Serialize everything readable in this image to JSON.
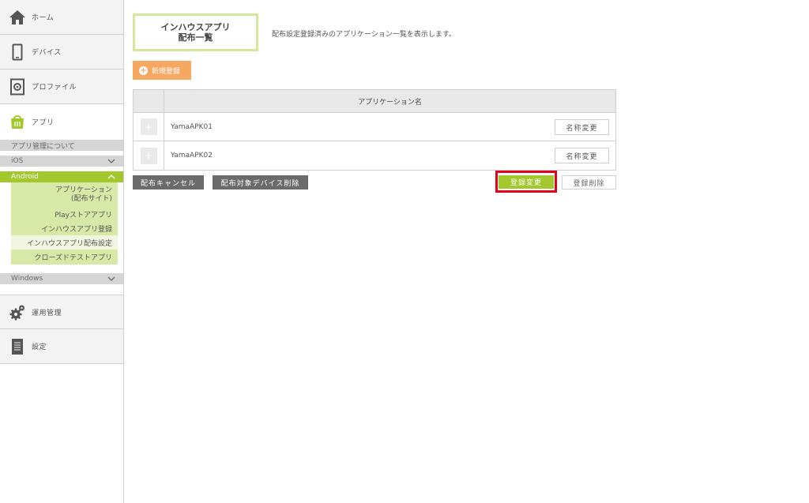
{
  "sidebar": {
    "home": "ホーム",
    "device": "デバイス",
    "profile": "プロファイル",
    "app": "アプリ",
    "app_management": "アプリ管理について",
    "ios": "iOS",
    "android": "Android",
    "android_items": [
      "アプリケーション",
      "(配布サイト)",
      "Playストアアプリ",
      "インハウスアプリ登録",
      "インハウスアプリ配布設定",
      "クローズドテストアプリ"
    ],
    "windows": "Windows",
    "operations": "運用管理",
    "settings": "設定"
  },
  "main": {
    "title_line1": "インハウスアプリ",
    "title_line2": "配布一覧",
    "description": "配布設定登録済みのアプリケーション一覧を表示します。",
    "new_button": "新規登録",
    "table_header": "アプリケーション名",
    "rows": [
      {
        "name": "YamaAPK01",
        "rename": "名称変更"
      },
      {
        "name": "YamaAPK02",
        "rename": "名称変更"
      }
    ],
    "cancel_button": "配布キャンセル",
    "delete_devices_button": "配布対象デバイス削除",
    "register_change_button": "登録変更",
    "register_delete_button": "登録削除"
  },
  "colors": {
    "accent_green": "#a3c82d",
    "orange": "#f6a860",
    "highlight_red": "#e3001b"
  }
}
